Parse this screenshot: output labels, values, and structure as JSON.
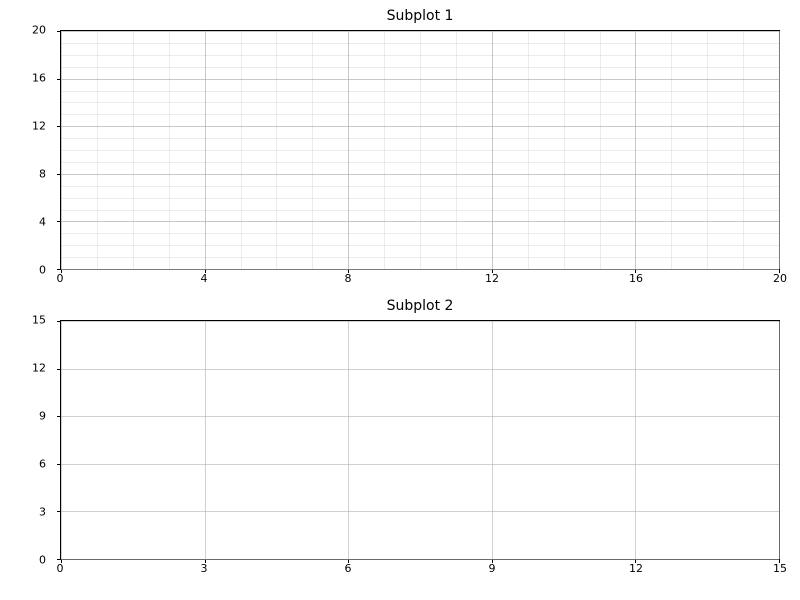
{
  "chart_data": [
    {
      "type": "line",
      "title": "Subplot 1",
      "xlabel": "",
      "ylabel": "",
      "xlim": [
        0,
        20
      ],
      "ylim": [
        0,
        20
      ],
      "x_major_ticks": [
        0,
        4,
        8,
        12,
        16,
        20
      ],
      "y_major_ticks": [
        0,
        4,
        8,
        12,
        16,
        20
      ],
      "x_minor_step": 1,
      "y_minor_step": 1,
      "grid": {
        "major": true,
        "minor": true
      },
      "series": []
    },
    {
      "type": "line",
      "title": "Subplot 2",
      "xlabel": "",
      "ylabel": "",
      "xlim": [
        0,
        15
      ],
      "ylim": [
        0,
        15
      ],
      "x_major_ticks": [
        0,
        3,
        6,
        9,
        12,
        15
      ],
      "y_major_ticks": [
        0,
        3,
        6,
        9,
        12,
        15
      ],
      "x_minor_step": null,
      "y_minor_step": null,
      "grid": {
        "major": true,
        "minor": false
      },
      "series": []
    }
  ]
}
